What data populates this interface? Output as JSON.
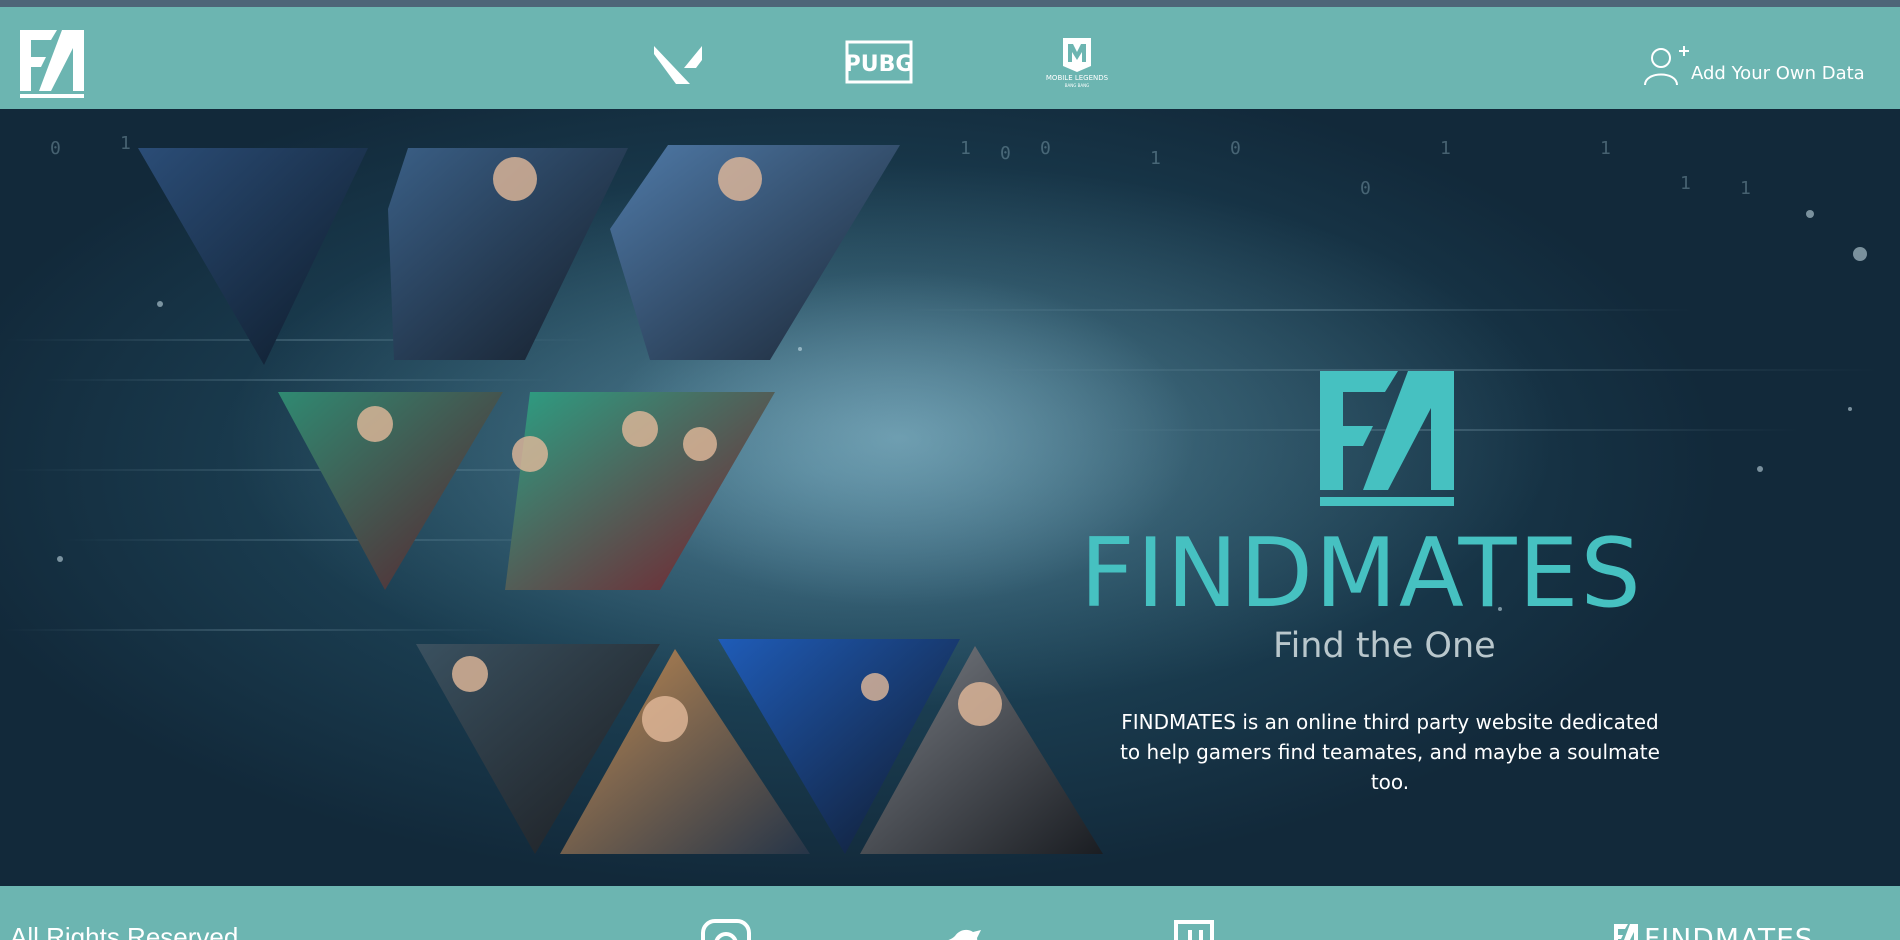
{
  "header": {
    "add_data_label": "Add Your Own Data",
    "games": [
      {
        "name": "VALORANT"
      },
      {
        "name": "PUBG"
      },
      {
        "name": "MOBILE LEGENDS"
      }
    ],
    "pubg_label": "PUBG",
    "mlbb_label": "MOBILE LEGENDS",
    "mlbb_sublabel": "BANG BANG"
  },
  "hero": {
    "title": "FINDMATES",
    "tagline": "Find the One",
    "description_line1": "FINDMATES is an online third party website dedicated",
    "description_line2": "to help gamers find teamates, and maybe a soulmate too."
  },
  "footer": {
    "copyright": "All Rights Reserved",
    "logo_text": "FINDMATES"
  },
  "colors": {
    "navbar": "#6cb5b1",
    "brand_teal": "#46c1c1",
    "hero_dark": "#12293a"
  },
  "icons": [
    "fm-logo-icon",
    "valorant-icon",
    "pubg-icon",
    "mobile-legends-icon",
    "add-user-icon",
    "instagram-icon",
    "twitter-icon",
    "twitch-icon"
  ]
}
